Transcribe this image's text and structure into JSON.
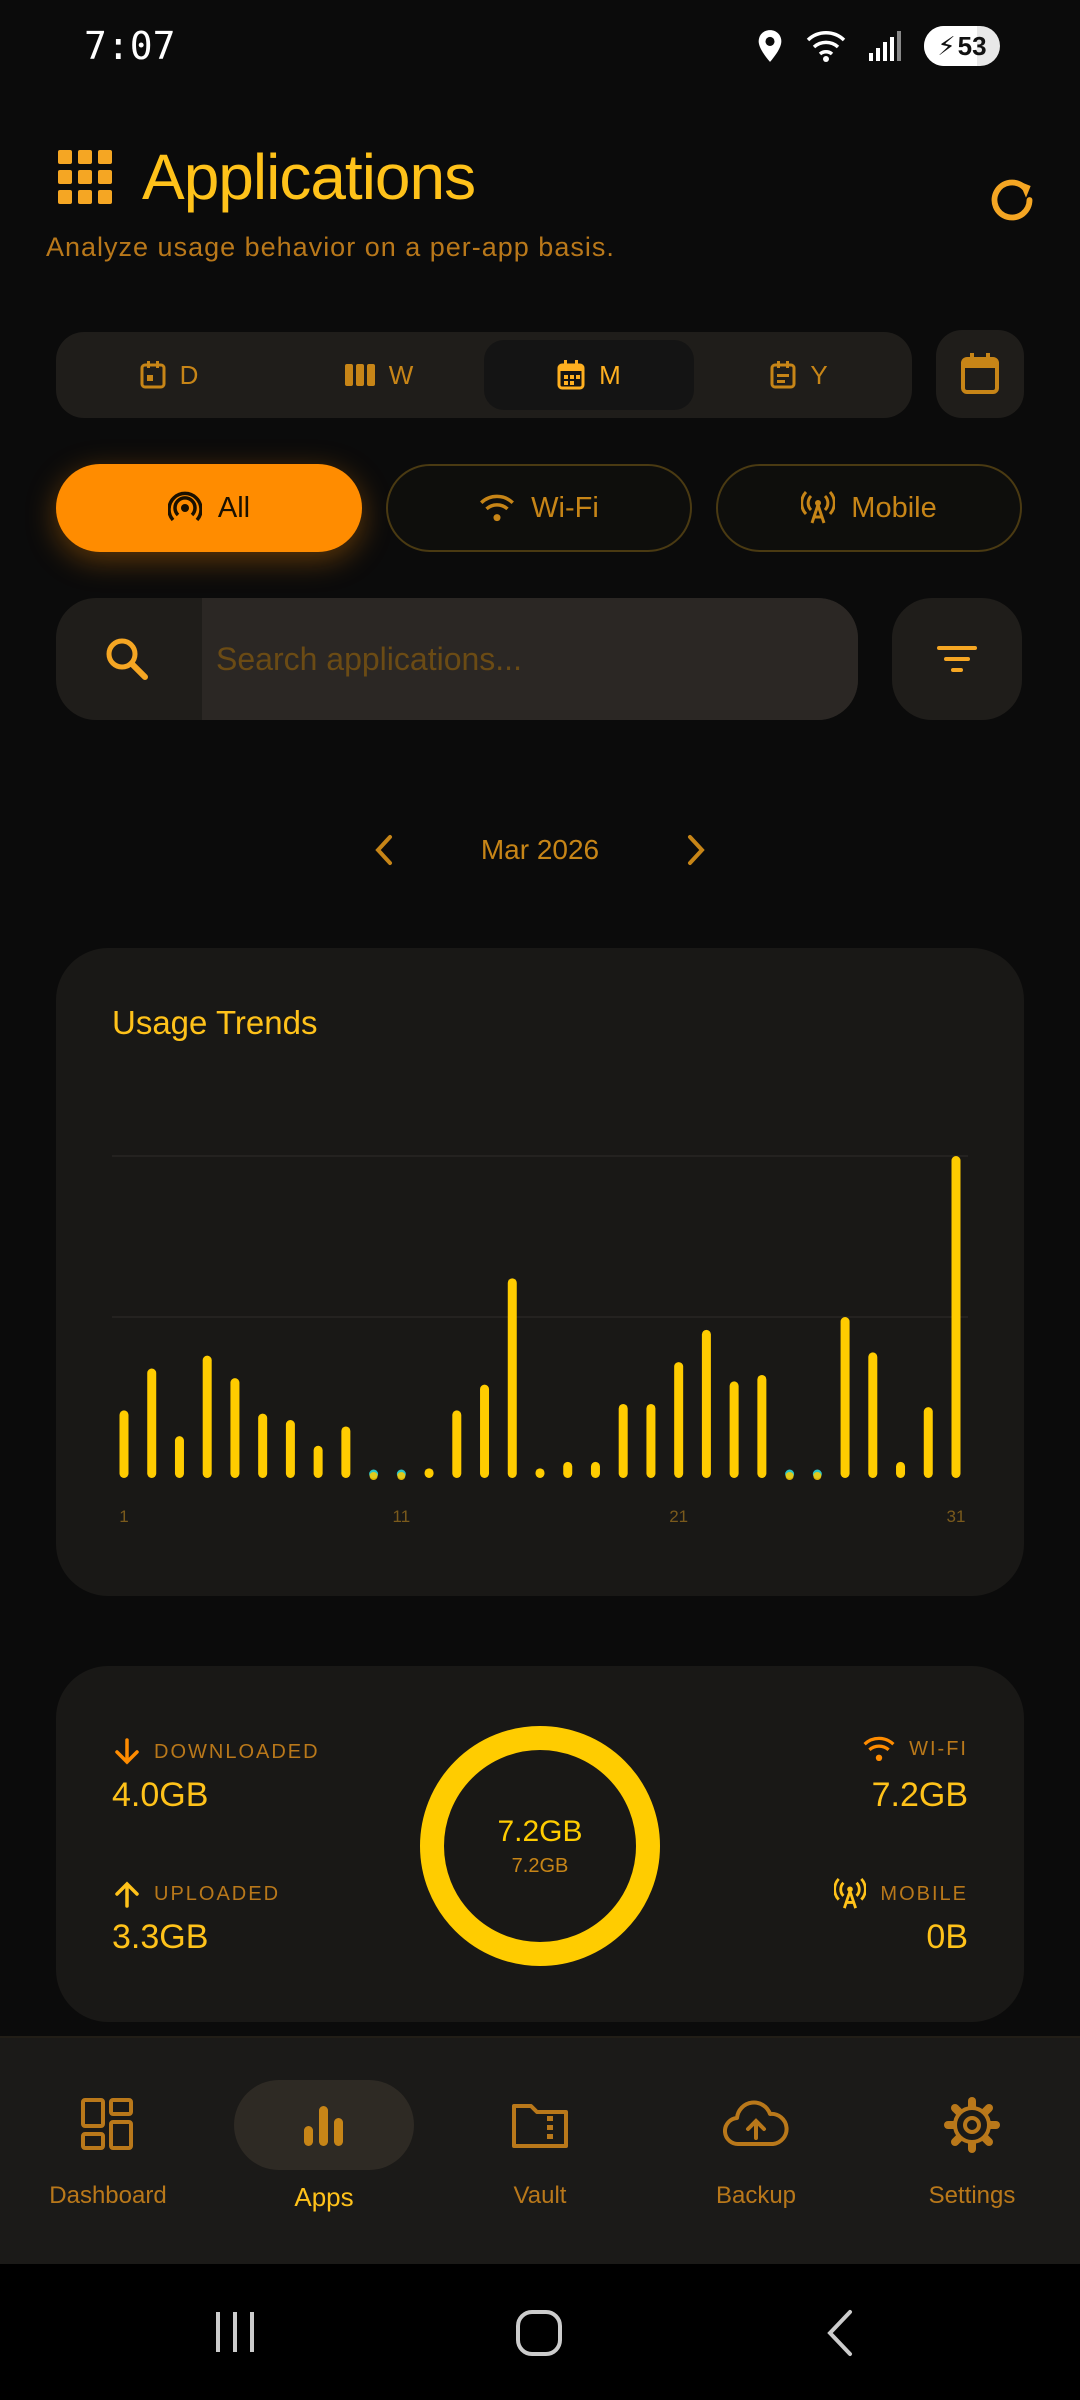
{
  "status_bar": {
    "time": "7:07",
    "battery": "53"
  },
  "header": {
    "title": "Applications",
    "subtitle": "Analyze usage behavior on a per-app basis."
  },
  "period_tabs": [
    {
      "label": "D",
      "active": false
    },
    {
      "label": "W",
      "active": false
    },
    {
      "label": "M",
      "active": true
    },
    {
      "label": "Y",
      "active": false
    }
  ],
  "filters": [
    {
      "label": "All",
      "active": true
    },
    {
      "label": "Wi-Fi",
      "active": false
    },
    {
      "label": "Mobile",
      "active": false
    }
  ],
  "search": {
    "placeholder": "Search applications...",
    "value": ""
  },
  "month_nav": {
    "label": "Mar 2026"
  },
  "chart_data": {
    "type": "bar",
    "title": "Usage Trends",
    "x": [
      1,
      2,
      3,
      4,
      5,
      6,
      7,
      8,
      9,
      10,
      11,
      12,
      13,
      14,
      15,
      16,
      17,
      18,
      19,
      20,
      21,
      22,
      23,
      24,
      25,
      26,
      27,
      28,
      29,
      30,
      31
    ],
    "x_tick_labels": [
      "1",
      "11",
      "21",
      "31"
    ],
    "values": [
      0.21,
      0.34,
      0.13,
      0.38,
      0.31,
      0.2,
      0.18,
      0.1,
      0.16,
      0.01,
      0.01,
      0.03,
      0.21,
      0.29,
      0.62,
      0.03,
      0.05,
      0.05,
      0.23,
      0.23,
      0.36,
      0.46,
      0.3,
      0.32,
      0.01,
      0.01,
      0.5,
      0.39,
      0.05,
      0.22,
      1.0
    ],
    "low_usage_days": [
      10,
      11,
      25,
      26
    ],
    "colors": {
      "bar": "#ffcc00",
      "low": "#2ec4c4"
    },
    "grid": true,
    "ylim": [
      0,
      1.0
    ]
  },
  "stats": {
    "downloaded": {
      "label": "DOWNLOADED",
      "value": "4.0GB"
    },
    "uploaded": {
      "label": "UPLOADED",
      "value": "3.3GB"
    },
    "wifi": {
      "label": "WI-FI",
      "value": "7.2GB"
    },
    "mobile": {
      "label": "MOBILE",
      "value": "0B"
    },
    "total_main": "7.2GB",
    "total_sub": "7.2GB"
  },
  "bottom_nav": [
    {
      "label": "Dashboard",
      "icon": "dashboard-icon",
      "active": false
    },
    {
      "label": "Apps",
      "icon": "bar-chart-icon",
      "active": true
    },
    {
      "label": "Vault",
      "icon": "folder-zip-icon",
      "active": false
    },
    {
      "label": "Backup",
      "icon": "cloud-upload-icon",
      "active": false
    },
    {
      "label": "Settings",
      "icon": "gear-icon",
      "active": false
    }
  ],
  "theme": {
    "accent": "#ffc21a",
    "active_chip": "#ff8c00",
    "background": "#0b0b0b",
    "card": "#191816"
  }
}
